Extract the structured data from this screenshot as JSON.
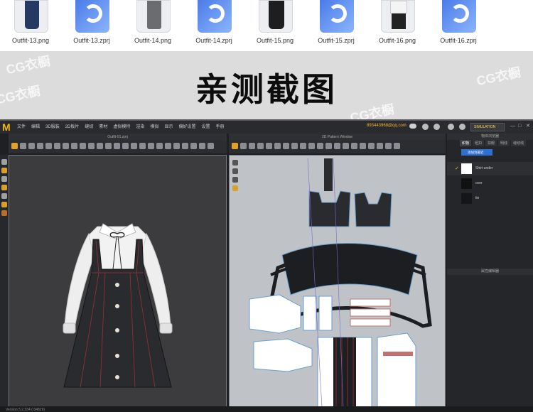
{
  "files": [
    {
      "name": "Outfit-13.png",
      "kind": "png",
      "figure": "jacket"
    },
    {
      "name": "Outfit-13.zprj",
      "kind": "zprj"
    },
    {
      "name": "Outfit-14.png",
      "kind": "png",
      "figure": "pants"
    },
    {
      "name": "Outfit-14.zprj",
      "kind": "zprj"
    },
    {
      "name": "Outfit-15.png",
      "kind": "png",
      "figure": "dress"
    },
    {
      "name": "Outfit-15.zprj",
      "kind": "zprj"
    },
    {
      "name": "Outfit-16.png",
      "kind": "png",
      "figure": "shirt-skirt"
    },
    {
      "name": "Outfit-16.zprj",
      "kind": "zprj"
    }
  ],
  "banner": {
    "title": "亲测截图",
    "watermarks": [
      "CG衣橱",
      "CG衣橱",
      "CG衣橱",
      "CG衣橱"
    ]
  },
  "app": {
    "logo": "M",
    "menu": [
      "文件",
      "编辑",
      "3D服装",
      "2D板片",
      "缝纫",
      "素材",
      "虚拟模特",
      "渲染",
      "模拟",
      "显示",
      "偏好设置",
      "设置",
      "手册"
    ],
    "account": "893443968@qq.com",
    "simulation_label": "SIMULATION",
    "window_controls": [
      "—",
      "□",
      "✕"
    ],
    "panel_3d_title": "Outfit-01.zprj",
    "panel_2d_title": "2D Pattern Window",
    "object_browser_title": "物体浏览器",
    "tabs": [
      "织物",
      "纽扣",
      "扣眼",
      "明线",
      "缝纫线"
    ],
    "tabs_active": 0,
    "add_button": "添加到最近",
    "fabrics": [
      {
        "name": "Shirt under",
        "color": "#ffffff",
        "checked": true
      },
      {
        "name": "over",
        "color": "#111111",
        "checked": false
      },
      {
        "name": "tie",
        "color": "#15161a",
        "checked": false
      }
    ],
    "property_editor_title": "属性编辑器",
    "status_text": "Version 5.2.334 (r34829)"
  },
  "colors": {
    "accent": "#f2b90f",
    "app_bg": "#1f2023",
    "pattern_bg": "#bfc2c7",
    "selected_blue": "#2f6fcf"
  }
}
